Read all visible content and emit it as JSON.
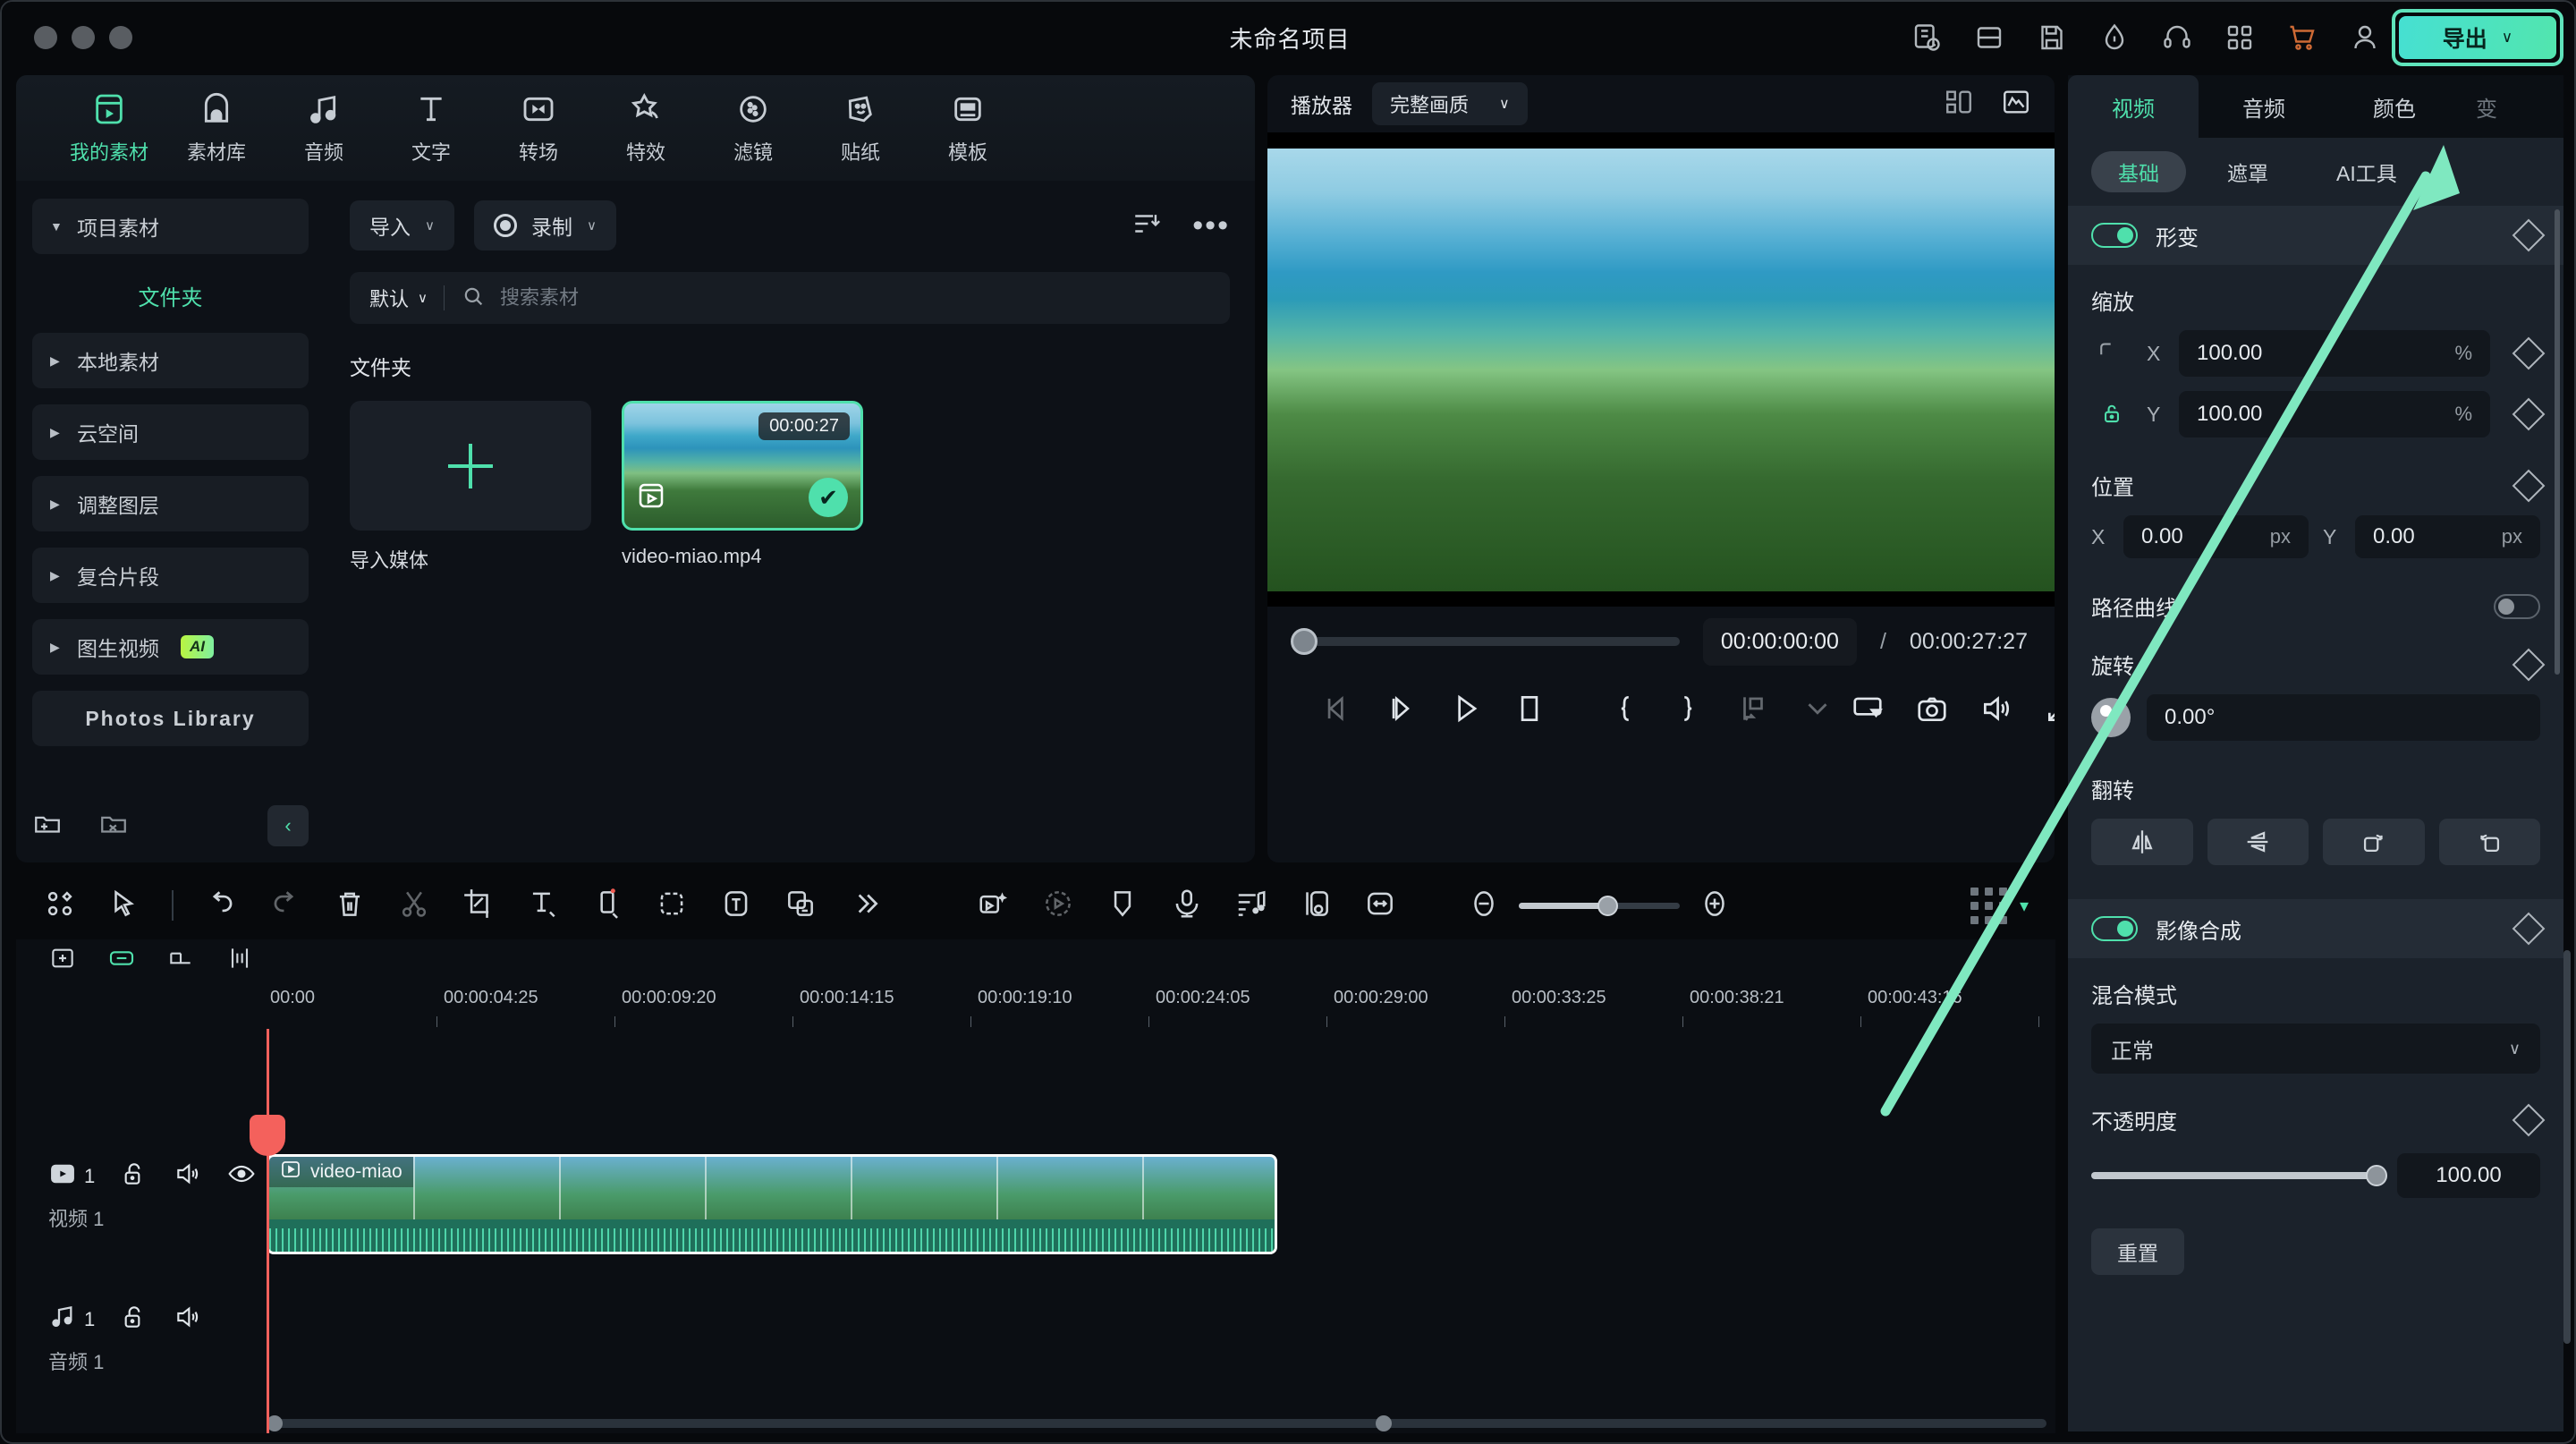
{
  "titlebar": {
    "project_title": "未命名项目",
    "export_label": "导出",
    "export_chevron": "∨",
    "icons": [
      "layout-history-icon",
      "split-view-icon",
      "save-icon",
      "speed-icon",
      "headset-icon",
      "grid-apps-icon",
      "cart-icon",
      "account-icon"
    ]
  },
  "nav_tabs": [
    {
      "label": "我的素材",
      "icon": "my-media-icon",
      "active": true
    },
    {
      "label": "素材库",
      "icon": "stock-library-icon",
      "active": false
    },
    {
      "label": "音频",
      "icon": "audio-note-icon",
      "active": false
    },
    {
      "label": "文字",
      "icon": "text-t-icon",
      "active": false
    },
    {
      "label": "转场",
      "icon": "transition-icon",
      "active": false
    },
    {
      "label": "特效",
      "icon": "effects-star-icon",
      "active": false
    },
    {
      "label": "滤镜",
      "icon": "filter-circle-icon",
      "active": false
    },
    {
      "label": "贴纸",
      "icon": "sticker-smile-icon",
      "active": false
    },
    {
      "label": "模板",
      "icon": "template-icon",
      "active": false
    }
  ],
  "sidebar": {
    "root": {
      "label": "项目素材",
      "caret": "▼"
    },
    "sub": {
      "label": "文件夹"
    },
    "items": [
      {
        "label": "本地素材",
        "caret": "▶"
      },
      {
        "label": "云空间",
        "caret": "▶"
      },
      {
        "label": "调整图层",
        "caret": "▶"
      },
      {
        "label": "复合片段",
        "caret": "▶"
      },
      {
        "label": "图生视频",
        "caret": "▶",
        "badge": "AI"
      }
    ],
    "photos_library": "Photos Library",
    "footer_icons": [
      "new-folder-icon",
      "delete-folder-icon",
      "collapse-panel-icon"
    ],
    "collapse_glyph": "‹"
  },
  "media_toolbar": {
    "import_label": "导入",
    "import_chevron": "∨",
    "record_label": "录制",
    "record_chevron": "∨",
    "filter_icon": "filter-sort-icon",
    "more_glyph": "•••"
  },
  "search": {
    "sort_label": "默认",
    "sort_chevron": "∨",
    "placeholder": "搜索素材",
    "value": "",
    "icon": "search-icon"
  },
  "media": {
    "folder_heading": "文件夹",
    "import_cell_label": "导入媒体",
    "clip": {
      "name": "video-miao.mp4",
      "duration": "00:00:27",
      "selected": true,
      "check_glyph": "✔"
    }
  },
  "player": {
    "label": "播放器",
    "quality": "完整画质",
    "quality_chevron": "∨",
    "head_icons": [
      "layout-grid-icon",
      "waveform-scope-icon"
    ],
    "current_time": "00:00:00:00",
    "separator": "/",
    "total_time": "00:00:27:27",
    "controls": [
      "prev-frame-icon",
      "next-frame-icon",
      "play-icon",
      "stop-icon",
      "mark-in-icon",
      "mark-out-icon",
      "snapshot-track-icon",
      "dropdown-caret-icon",
      "screen-cast-icon",
      "camera-icon",
      "volume-icon",
      "fullscreen-icon"
    ]
  },
  "properties": {
    "tabs": [
      {
        "label": "视频",
        "active": true
      },
      {
        "label": "音频",
        "active": false
      },
      {
        "label": "颜色",
        "active": false
      },
      {
        "label": "变",
        "active": false,
        "clipped": true
      }
    ],
    "sub_tabs": [
      {
        "label": "基础",
        "active": true
      },
      {
        "label": "遮罩",
        "active": false
      },
      {
        "label": "AI工具",
        "active": false
      }
    ],
    "transform": {
      "title": "形变",
      "enabled": true,
      "scale_label": "缩放",
      "scale_x_axis": "X",
      "scale_x": "100.00",
      "scale_x_unit": "%",
      "scale_y_axis": "Y",
      "scale_y": "100.00",
      "scale_y_unit": "%",
      "link_icon": "lock-linked-icon",
      "position_label": "位置",
      "pos_x_axis": "X",
      "pos_x": "0.00",
      "pos_x_unit": "px",
      "pos_y_axis": "Y",
      "pos_y": "0.00",
      "pos_y_unit": "px",
      "path_curve_label": "路径曲线",
      "path_curve_enabled": false,
      "rotation_label": "旋转",
      "rotation": "0.00°",
      "flip_label": "翻转",
      "flip_buttons": [
        "flip-horizontal-icon",
        "flip-vertical-icon",
        "rotate-right-icon",
        "rotate-left-icon"
      ]
    },
    "compositing": {
      "title": "影像合成",
      "enabled": true,
      "blend_label": "混合模式",
      "blend_value": "正常",
      "blend_chevron": "∨",
      "opacity_label": "不透明度",
      "opacity_value": "100.00"
    },
    "reset_label": "重置",
    "keyframe_icon": "keyframe-diamond-icon"
  },
  "timeline_toolbar": {
    "left_icons": [
      "marker-panel-icon",
      "select-tool-icon"
    ],
    "edit_icons": [
      "undo-icon",
      "redo-icon",
      "delete-icon",
      "split-scissors-icon",
      "crop-icon",
      "add-text-icon",
      "add-clip-icon",
      "mask-icon",
      "auto-caption-icon",
      "translate-icon",
      "more-chevrons-icon"
    ],
    "right_icons": [
      "ai-smart-cutout-icon",
      "motion-track-icon",
      "marker-tag-icon",
      "voiceover-icon",
      "audio-mix-icon",
      "keyframe-panel-icon",
      "fit-timeline-icon"
    ],
    "zoom_out_glyph": "−",
    "zoom_in_glyph": "+",
    "grid_icon": "render-grid-icon",
    "caret_glyph": "▾"
  },
  "timeline": {
    "head_icons": [
      "add-track-icon",
      "link-clips-icon",
      "group-icon",
      "align-icon"
    ],
    "ruler_ticks": [
      "00:00",
      "00:00:04:25",
      "00:00:09:20",
      "00:00:14:15",
      "00:00:19:10",
      "00:00:24:05",
      "00:00:29:00",
      "00:00:33:25",
      "00:00:38:21",
      "00:00:43:16"
    ],
    "tracks": [
      {
        "index": "1",
        "name": "视频 1",
        "type": "video",
        "icons": [
          "video-track-icon",
          "unlock-icon",
          "mute-icon",
          "eye-visible-icon"
        ]
      },
      {
        "index": "1",
        "name": "音频 1",
        "type": "audio",
        "icons": [
          "audio-track-icon",
          "unlock-icon",
          "mute-icon"
        ]
      }
    ],
    "clip_name": "video-miao",
    "clip_play_icon": "play-small-icon"
  },
  "colors": {
    "accent_green": "#4fe0ac",
    "export_gradient_start": "#46e0d2",
    "export_gradient_end": "#52e5ae",
    "playhead_red": "#f4615c",
    "panel_bg": "#0d1117",
    "props_bg": "#1b222b",
    "ai_badge": "#b9f541"
  }
}
